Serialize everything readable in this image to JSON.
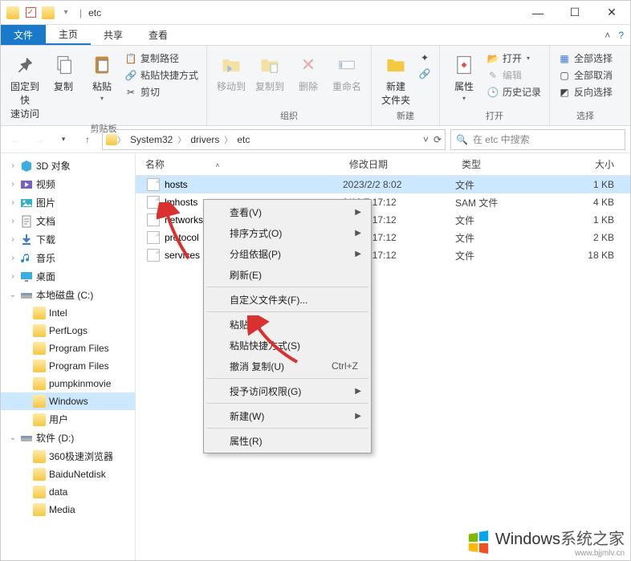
{
  "title": "etc",
  "tabs": {
    "file": "文件",
    "home": "主页",
    "share": "共享",
    "view": "查看"
  },
  "ribbon": {
    "clipboard": {
      "label": "剪贴板",
      "pin": "固定到快\n速访问",
      "copy": "复制",
      "paste": "粘贴",
      "copy_path": "复制路径",
      "paste_shortcut": "粘贴快捷方式",
      "cut": "剪切"
    },
    "organize": {
      "label": "组织",
      "move_to": "移动到",
      "copy_to": "复制到",
      "delete": "删除",
      "rename": "重命名"
    },
    "new": {
      "label": "新建",
      "new_folder": "新建\n文件夹"
    },
    "open": {
      "label": "打开",
      "properties": "属性",
      "open": "打开",
      "edit": "编辑",
      "history": "历史记录"
    },
    "select": {
      "label": "选择",
      "select_all": "全部选择",
      "deselect_all": "全部取消",
      "invert": "反向选择"
    }
  },
  "breadcrumb": [
    "System32",
    "drivers",
    "etc"
  ],
  "search_placeholder": "在 etc 中搜索",
  "columns": {
    "name": "名称",
    "date": "修改日期",
    "type": "类型",
    "size": "大小"
  },
  "files": [
    {
      "name": "hosts",
      "date": "2023/2/2 8:02",
      "type": "文件",
      "size": "1 KB",
      "selected": true
    },
    {
      "name": "lmhosts",
      "date": "9/12/7 17:12",
      "type": "SAM 文件",
      "size": "4 KB"
    },
    {
      "name": "networks",
      "date": "9/12/7 17:12",
      "type": "文件",
      "size": "1 KB"
    },
    {
      "name": "protocol",
      "date": "9/12/7 17:12",
      "type": "文件",
      "size": "2 KB"
    },
    {
      "name": "services",
      "date": "9/12/7 17:12",
      "type": "文件",
      "size": "18 KB"
    }
  ],
  "sidebar": [
    {
      "label": "3D 对象",
      "icon": "cube",
      "indent": 0
    },
    {
      "label": "视频",
      "icon": "video",
      "indent": 0
    },
    {
      "label": "图片",
      "icon": "pic",
      "indent": 0
    },
    {
      "label": "文档",
      "icon": "doc",
      "indent": 0
    },
    {
      "label": "下载",
      "icon": "download",
      "indent": 0
    },
    {
      "label": "音乐",
      "icon": "music",
      "indent": 0
    },
    {
      "label": "桌面",
      "icon": "desktop",
      "indent": 0
    },
    {
      "label": "本地磁盘 (C:)",
      "icon": "drive",
      "indent": 0,
      "chevron": "open"
    },
    {
      "label": "Intel",
      "icon": "folder",
      "indent": 1
    },
    {
      "label": "PerfLogs",
      "icon": "folder",
      "indent": 1
    },
    {
      "label": "Program Files",
      "icon": "folder",
      "indent": 1
    },
    {
      "label": "Program Files",
      "icon": "folder",
      "indent": 1
    },
    {
      "label": "pumpkinmovie",
      "icon": "folder",
      "indent": 1
    },
    {
      "label": "Windows",
      "icon": "folder",
      "indent": 1,
      "selected": true
    },
    {
      "label": "用户",
      "icon": "folder",
      "indent": 1
    },
    {
      "label": "软件 (D:)",
      "icon": "drive",
      "indent": 0,
      "chevron": "open"
    },
    {
      "label": "360极速浏览器",
      "icon": "folder",
      "indent": 1
    },
    {
      "label": "BaiduNetdisk",
      "icon": "folder",
      "indent": 1
    },
    {
      "label": "data",
      "icon": "folder",
      "indent": 1
    },
    {
      "label": "Media",
      "icon": "folder",
      "indent": 1
    }
  ],
  "context_menu": [
    {
      "label": "查看(V)",
      "sub": true
    },
    {
      "label": "排序方式(O)",
      "sub": true
    },
    {
      "label": "分组依据(P)",
      "sub": true
    },
    {
      "label": "刷新(E)"
    },
    {
      "sep": true
    },
    {
      "label": "自定义文件夹(F)..."
    },
    {
      "sep": true
    },
    {
      "label": "粘贴(P)"
    },
    {
      "label": "粘贴快捷方式(S)"
    },
    {
      "label": "撤消 复制(U)",
      "shortcut": "Ctrl+Z"
    },
    {
      "sep": true
    },
    {
      "label": "授予访问权限(G)",
      "sub": true
    },
    {
      "sep": true
    },
    {
      "label": "新建(W)",
      "sub": true
    },
    {
      "sep": true
    },
    {
      "label": "属性(R)"
    }
  ],
  "watermark": {
    "brand": "Windows",
    "suffix": "系统之家",
    "url": "www.bjjmlv.cn"
  }
}
